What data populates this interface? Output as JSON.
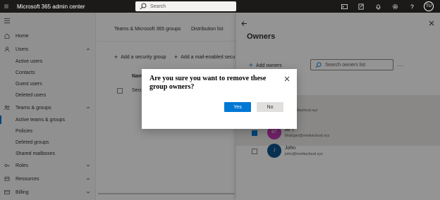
{
  "header": {
    "app_title": "Microsoft 365 admin center",
    "search_placeholder": "Search",
    "icons": [
      "terminal-icon",
      "edit-icon",
      "bell-icon",
      "gear-icon",
      "help-icon"
    ],
    "user_initials": "TU"
  },
  "nav": {
    "items": [
      {
        "label": "Home",
        "icon": "home-icon"
      },
      {
        "label": "Users",
        "icon": "user-icon"
      },
      {
        "label": "Teams & groups",
        "icon": "teams-icon"
      },
      {
        "label": "Roles",
        "icon": "key-icon"
      },
      {
        "label": "Resources",
        "icon": "resources-icon"
      },
      {
        "label": "Billing",
        "icon": "card-icon"
      }
    ],
    "users_sub": [
      "Active users",
      "Contacts",
      "Guest users",
      "Deleted users"
    ],
    "teams_sub": [
      "Active teams & groups",
      "Policies",
      "Deleted groups",
      "Shared mailboxes"
    ]
  },
  "main": {
    "tabs": [
      "Teams & Microsoft 365 groups",
      "Distribution list"
    ],
    "commands": [
      "Add a security group",
      "Add a mail-enabled secu"
    ],
    "column_name": "Nam",
    "row_name": "Secu"
  },
  "panel": {
    "title": "Owners",
    "add_owners": "Add owners",
    "search_placeholder": "Search owners list",
    "more": "...",
    "owners": [
      {
        "name": "th",
        "email": "n@mediacloud.xyz",
        "initials": "",
        "color": "#4f6bed",
        "selected": true
      },
      {
        "name": "av T",
        "email": "bhargav@mediacloud.xyz",
        "initials": "BT",
        "color": "#c239b3",
        "selected": true
      },
      {
        "name": "John",
        "email": "john@mediacloud.xyz",
        "initials": "J",
        "color": "#0f548c",
        "selected": false
      }
    ]
  },
  "dialog": {
    "title": "Are you sure you want to remove these group owners?",
    "yes_label": "Yes",
    "no_label": "No"
  },
  "colors": {
    "accent": "#0078d4",
    "topbar": "#1b1a19"
  }
}
